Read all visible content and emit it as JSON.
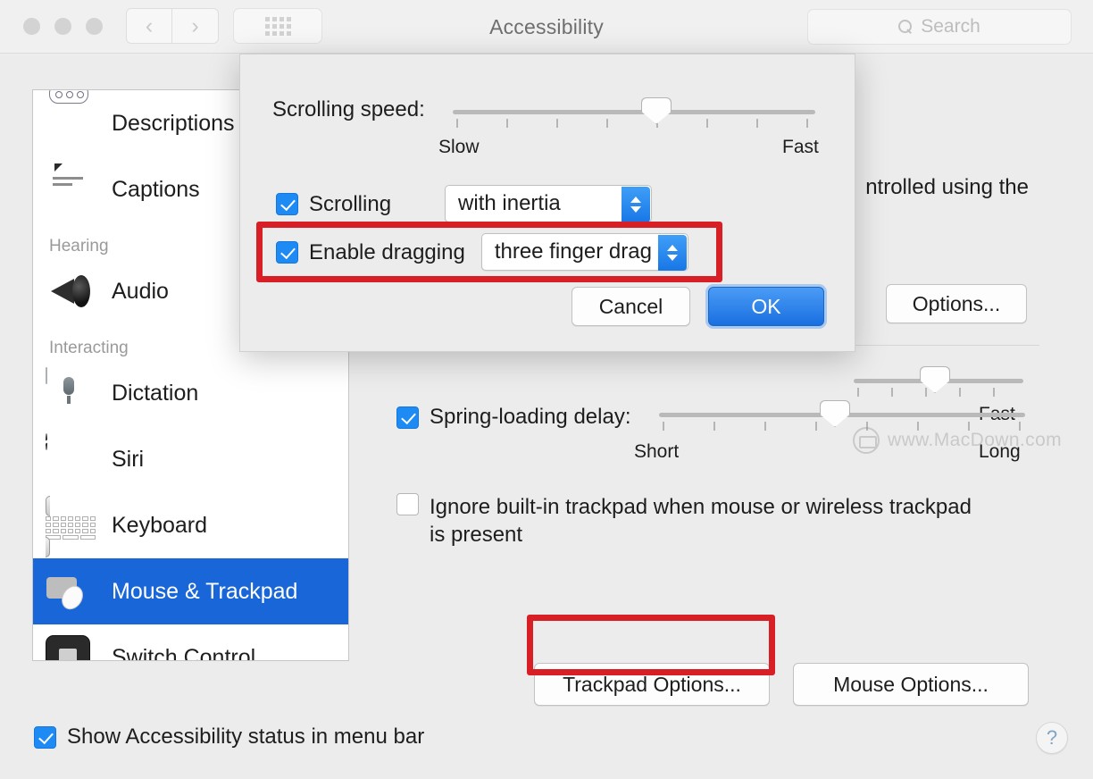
{
  "window": {
    "title": "Accessibility",
    "nav": {
      "back": "‹",
      "forward": "›"
    },
    "search": {
      "placeholder": "Search",
      "value": ""
    }
  },
  "sidebar": {
    "items": [
      {
        "label": "Descriptions",
        "icon": "descriptions-icon",
        "selected": false
      },
      {
        "label": "Captions",
        "icon": "captions-icon",
        "selected": false
      },
      {
        "label": "Audio",
        "icon": "audio-icon",
        "selected": false
      },
      {
        "label": "Dictation",
        "icon": "dictation-icon",
        "selected": false
      },
      {
        "label": "Siri",
        "icon": "siri-icon",
        "selected": false
      },
      {
        "label": "Keyboard",
        "icon": "keyboard-icon",
        "selected": false
      },
      {
        "label": "Mouse & Trackpad",
        "icon": "mouse-trackpad-icon",
        "selected": true
      },
      {
        "label": "Switch Control",
        "icon": "switch-control-icon",
        "selected": false
      }
    ],
    "sections": {
      "hearing": "Hearing",
      "interacting": "Interacting"
    }
  },
  "pane": {
    "partial_text": "ntrolled using the",
    "options_button": "Options...",
    "speed_slider": {
      "fast_label": "Fast",
      "value_pct": 52
    },
    "spring_loading": {
      "label": "Spring-loading delay:",
      "checked": true,
      "short_label": "Short",
      "long_label": "Long",
      "value_pct": 48
    },
    "ignore_trackpad": {
      "line1": "Ignore built-in trackpad when mouse or wireless trackpad",
      "line2": "is present",
      "checked": false
    },
    "trackpad_options_button": "Trackpad Options...",
    "mouse_options_button": "Mouse Options..."
  },
  "dialog": {
    "scrolling_speed": {
      "label": "Scrolling speed:",
      "slow_label": "Slow",
      "fast_label": "Fast",
      "value_pct": 56
    },
    "scrolling": {
      "label": "Scrolling",
      "checked": true,
      "popup_value": "with inertia"
    },
    "enable_dragging": {
      "label": "Enable dragging",
      "checked": true,
      "popup_value": "three finger drag"
    },
    "cancel_button": "Cancel",
    "ok_button": "OK"
  },
  "footer": {
    "show_status": "Show Accessibility status in menu bar",
    "show_status_checked": true,
    "help": "?"
  },
  "watermark": {
    "text": "www.MacDown.com"
  },
  "colors": {
    "accent_blue": "#1866d8",
    "control_blue": "#1e8bf5",
    "annotation_red": "#d81f26"
  }
}
